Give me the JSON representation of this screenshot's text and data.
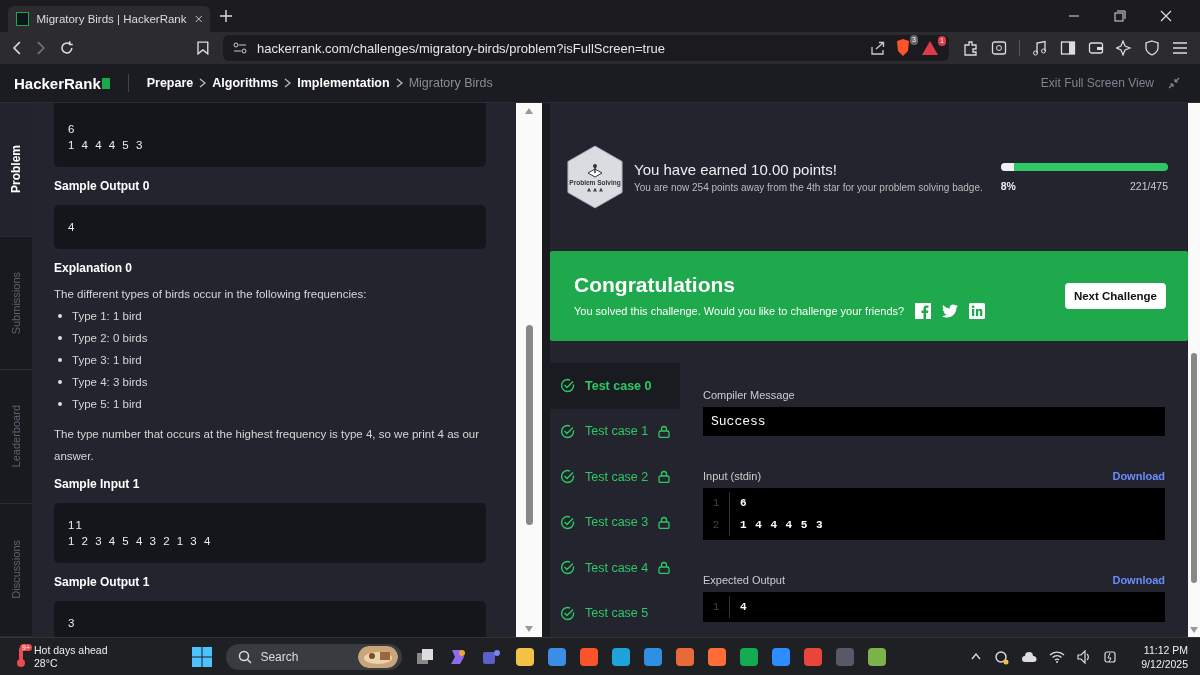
{
  "browser": {
    "tab_title": "Migratory Birds | HackerRank",
    "url": "hackerrank.com/challenges/migratory-birds/problem?isFullScreen=true",
    "shield_badge": "3",
    "alert_badge": "1"
  },
  "header": {
    "logo": "HackerRank",
    "breadcrumbs": [
      {
        "label": "Prepare",
        "current": false
      },
      {
        "label": "Algorithms",
        "current": false
      },
      {
        "label": "Implementation",
        "current": false
      },
      {
        "label": "Migratory Birds",
        "current": true
      }
    ],
    "exit": "Exit Full Screen View"
  },
  "side_tabs": [
    {
      "label": "Problem",
      "selected": true
    },
    {
      "label": "Submissions",
      "selected": false
    },
    {
      "label": "Leaderboard",
      "selected": false
    },
    {
      "label": "Discussions",
      "selected": false
    }
  ],
  "problem": [
    {
      "kind": "code",
      "lines": [
        "6",
        "1 4 4 4 5 3"
      ]
    },
    {
      "kind": "heading",
      "text": "Sample Output 0"
    },
    {
      "kind": "code",
      "lines": [
        "4"
      ]
    },
    {
      "kind": "heading",
      "text": "Explanation 0"
    },
    {
      "kind": "paragraph",
      "text": "The different types of birds occur in the following frequencies:"
    },
    {
      "kind": "list",
      "items": [
        "Type 1: 1 bird",
        "Type 2: 0 birds",
        "Type 3: 1 bird",
        "Type 4: 3 birds",
        "Type 5: 1 bird"
      ]
    },
    {
      "kind": "paragraph",
      "text": "The type number that occurs at the highest frequency is type 4, so we print 4 as our answer."
    },
    {
      "kind": "heading",
      "text": "Sample Input 1"
    },
    {
      "kind": "code",
      "lines": [
        "11",
        "1 2 3 4 5 4 3 2 1 3 4"
      ]
    },
    {
      "kind": "heading",
      "text": "Sample Output 1"
    },
    {
      "kind": "code",
      "lines": [
        "3"
      ]
    }
  ],
  "badge": {
    "label": "Problem Solving",
    "stars": 3
  },
  "earned": "You have earned 10.00 points!",
  "away": "You are now 254 points away from the 4th star for your problem solving badge.",
  "progress": {
    "level": 0.08,
    "percent": "8%",
    "count": "221/475"
  },
  "congrats": {
    "title": "Congratulations",
    "text": "You solved this challenge. Would you like to challenge your friends?",
    "button": "Next Challenge"
  },
  "test_cases": [
    {
      "label": "Test case 0",
      "selected": true,
      "locked": false
    },
    {
      "label": "Test case 1",
      "selected": false,
      "locked": true
    },
    {
      "label": "Test case 2",
      "selected": false,
      "locked": true
    },
    {
      "label": "Test case 3",
      "selected": false,
      "locked": true
    },
    {
      "label": "Test case 4",
      "selected": false,
      "locked": true
    },
    {
      "label": "Test case 5",
      "selected": false,
      "locked": false
    }
  ],
  "result": {
    "compiler_label": "Compiler Message",
    "compiler": "Success",
    "input_label": "Input (stdin)",
    "input_download": "Download",
    "input_lines": [
      {
        "no": "1",
        "text": "6"
      },
      {
        "no": "2",
        "text": "1 4 4 4 5 3"
      }
    ],
    "expected_label": "Expected Output",
    "expected_download": "Download",
    "expected_lines": [
      {
        "no": "1",
        "text": "4"
      }
    ]
  },
  "taskbar": {
    "weather_badge": "9+",
    "weather_title": "Hot days ahead",
    "temp": "28°C",
    "search": "Search",
    "time": "11:12 PM",
    "date": "9/12/2025"
  }
}
